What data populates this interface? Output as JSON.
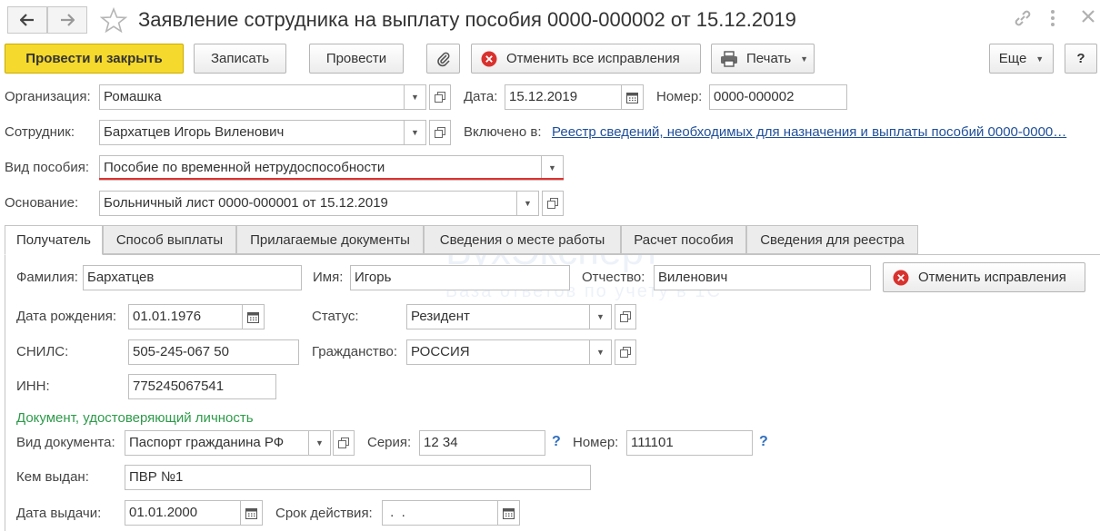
{
  "header": {
    "title": "Заявление сотрудника на выплату пособия 0000-000002 от 15.12.2019"
  },
  "toolbar": {
    "post_close": "Провести и закрыть",
    "save": "Записать",
    "post": "Провести",
    "cancel_all_corrections": "Отменить все исправления",
    "print": "Печать",
    "more": "Еще",
    "help": "?"
  },
  "form": {
    "organization_label": "Организация:",
    "organization": "Ромашка",
    "date_label": "Дата:",
    "date": "15.12.2019",
    "number_label": "Номер:",
    "number": "0000-000002",
    "employee_label": "Сотрудник:",
    "employee": "Бархатцев Игорь Виленович",
    "included_label": "Включено в:",
    "included_link": "Реестр сведений, необходимых для назначения и выплаты пособий 0000-0000…",
    "benefit_type_label": "Вид пособия:",
    "benefit_type": "Пособие по временной нетрудоспособности",
    "basis_label": "Основание:",
    "basis": "Больничный лист 0000-000001 от 15.12.2019"
  },
  "tabs": [
    "Получатель",
    "Способ выплаты",
    "Прилагаемые документы",
    "Сведения о месте работы",
    "Расчет пособия",
    "Сведения для реестра"
  ],
  "recipient": {
    "last_name_label": "Фамилия:",
    "last_name": "Бархатцев",
    "first_name_label": "Имя:",
    "first_name": "Игорь",
    "patronymic_label": "Отчество:",
    "patronymic": "Виленович",
    "cancel_corrections": "Отменить исправления",
    "birth_date_label": "Дата рождения:",
    "birth_date": "01.01.1976",
    "status_label": "Статус:",
    "status": "Резидент",
    "snils_label": "СНИЛС:",
    "snils": "505-245-067 50",
    "citizenship_label": "Гражданство:",
    "citizenship": "РОССИЯ",
    "inn_label": "ИНН:",
    "inn": "775245067541",
    "id_doc_section": "Документ, удостоверяющий личность",
    "doc_type_label": "Вид документа:",
    "doc_type": "Паспорт гражданина РФ",
    "series_label": "Серия:",
    "series": "12 34",
    "doc_number_label": "Номер:",
    "doc_number": "111101",
    "issued_by_label": "Кем выдан:",
    "issued_by": "ПВР №1",
    "issue_date_label": "Дата выдачи:",
    "issue_date": "01.01.2000",
    "valid_until_label": "Срок действия:",
    "valid_until": " .  ."
  },
  "watermark": {
    "brand": "БухЭксперт",
    "tagline": "База ответов по учету в 1С"
  },
  "colors": {
    "primary_button": "#f5d92c",
    "link": "#1f4f99",
    "section_heading": "#2e9a4a",
    "red_underline": "#e0312f",
    "cancel_icon": "#d8322e"
  }
}
